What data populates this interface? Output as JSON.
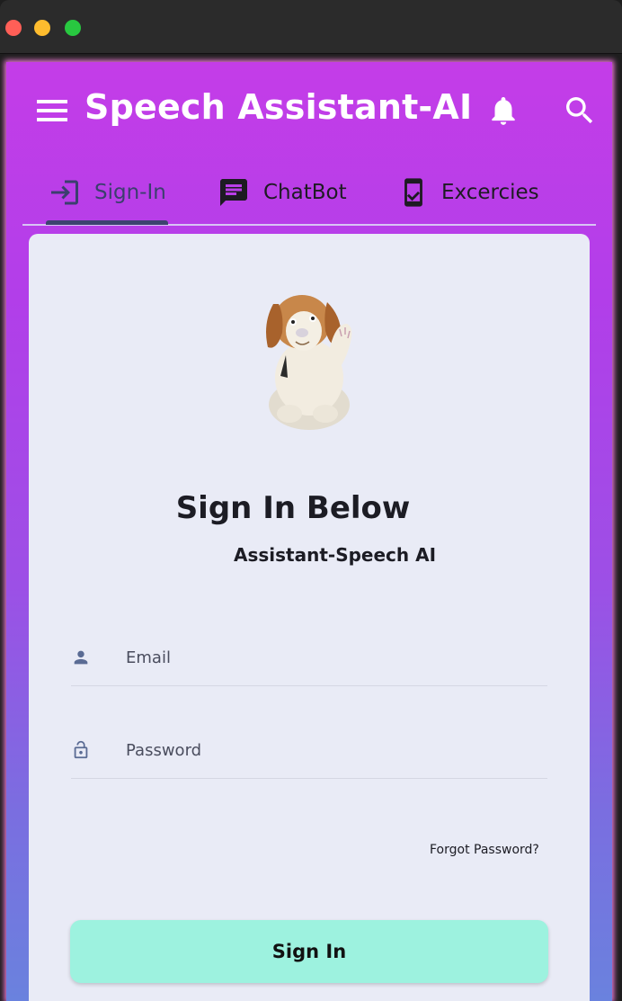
{
  "window": {
    "controls": [
      "close",
      "minimize",
      "zoom"
    ]
  },
  "appbar": {
    "title": "Speech Assistant-AI",
    "menu_icon": "menu-icon",
    "notification_icon": "bell-icon",
    "search_icon": "search-icon"
  },
  "tabs": [
    {
      "label": "Sign-In",
      "icon": "login-icon",
      "active": true
    },
    {
      "label": "ChatBot",
      "icon": "chat-icon",
      "active": false
    },
    {
      "label": "Excercies",
      "icon": "phone-check-icon",
      "active": false
    }
  ],
  "signin": {
    "title": "Sign In Below",
    "subtitle": "Assistant-Speech AI",
    "email_placeholder": "Email",
    "password_placeholder": "Password",
    "forgot_label": "Forgot Password?",
    "button_label": "Sign In"
  },
  "colors": {
    "gradient_top": "#c43de8",
    "gradient_bottom": "#6a82de",
    "card_background": "#e9ebf6",
    "button_background": "#9df2df",
    "field_icon": "#5a6b94"
  }
}
